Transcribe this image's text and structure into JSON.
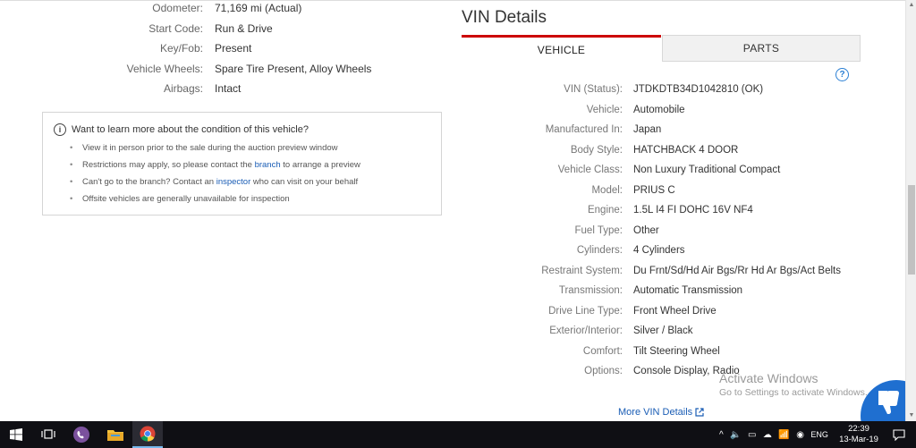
{
  "specs": [
    {
      "label": "Odometer:",
      "value": "71,169 mi (Actual)"
    },
    {
      "label": "Start Code:",
      "value": "Run & Drive"
    },
    {
      "label": "Key/Fob:",
      "value": "Present"
    },
    {
      "label": "Vehicle Wheels:",
      "value": "Spare Tire Present, Alloy Wheels"
    },
    {
      "label": "Airbags:",
      "value": "Intact"
    }
  ],
  "info_box": {
    "title": "Want to learn more about the condition of this vehicle?",
    "item1": "View it in person prior to the sale during the auction preview window",
    "item2_pre": "Restrictions may apply, so please contact the ",
    "item2_link": "branch",
    "item2_post": " to arrange a preview",
    "item3_pre": "Can't go to the branch? Contact an ",
    "item3_link": "inspector",
    "item3_post": " who can visit on your behalf",
    "item4": "Offsite vehicles are generally unavailable for inspection"
  },
  "vin_details": {
    "title": "VIN Details",
    "tab_vehicle": "VEHICLE",
    "tab_parts": "PARTS",
    "help_icon": "?",
    "rows": [
      {
        "label": "VIN (Status):",
        "value": "JTDKDTB34D1042810 (OK)"
      },
      {
        "label": "Vehicle:",
        "value": "Automobile"
      },
      {
        "label": "Manufactured In:",
        "value": "Japan"
      },
      {
        "label": "Body Style:",
        "value": "HATCHBACK 4 DOOR"
      },
      {
        "label": "Vehicle Class:",
        "value": "Non Luxury Traditional Compact"
      },
      {
        "label": "Model:",
        "value": "PRIUS C"
      },
      {
        "label": "Engine:",
        "value": "1.5L I4 FI DOHC 16V NF4"
      },
      {
        "label": "Fuel Type:",
        "value": "Other"
      },
      {
        "label": "Cylinders:",
        "value": "4 Cylinders"
      },
      {
        "label": "Restraint System:",
        "value": "Du Frnt/Sd/Hd Air Bgs/Rr Hd Ar Bgs/Act Belts"
      },
      {
        "label": "Transmission:",
        "value": "Automatic Transmission"
      },
      {
        "label": "Drive Line Type:",
        "value": "Front Wheel Drive"
      },
      {
        "label": "Exterior/Interior:",
        "value": "Silver / Black"
      },
      {
        "label": "Comfort:",
        "value": "Tilt Steering Wheel"
      },
      {
        "label": "Options:",
        "value": "Console Display, Radio"
      }
    ],
    "more_link": "More VIN Details"
  },
  "watermark": {
    "line1": "Activate Windows",
    "line2": "Go to Settings to activate Windows."
  },
  "taskbar": {
    "time": "22:39",
    "date": "13-Mar-19",
    "lang": "ENG"
  },
  "colors": {
    "accent_red": "#cc0000",
    "link_blue": "#1a5db5",
    "feedback_blue": "#1f6fd0"
  }
}
